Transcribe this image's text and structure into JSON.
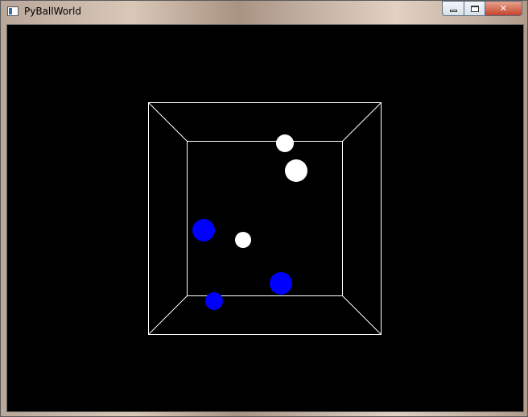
{
  "window": {
    "title": "PyBallWorld",
    "icon": "window-app-icon",
    "caption_buttons": [
      {
        "name": "minimize-icon"
      },
      {
        "name": "maximize-icon"
      },
      {
        "name": "close-icon",
        "glyph": "✕"
      }
    ]
  },
  "scene": {
    "background": "#000000",
    "box_color": "#ffffff",
    "ball_colors": {
      "white": "#ffffff",
      "blue": "#0000ff"
    }
  }
}
